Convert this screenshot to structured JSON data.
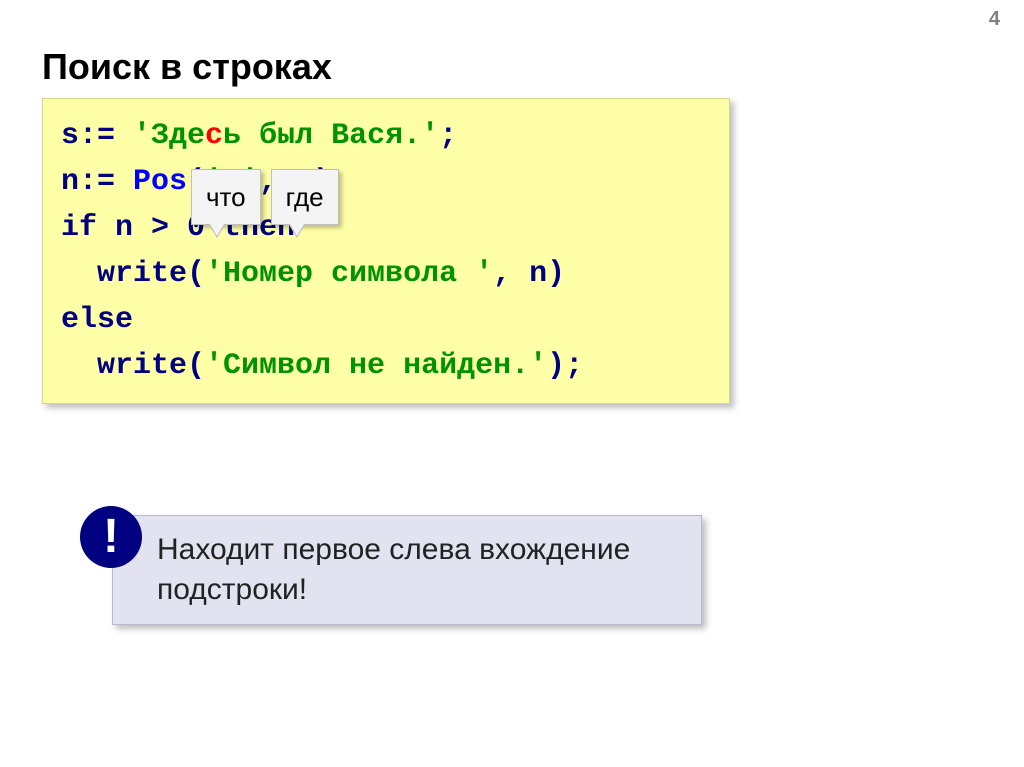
{
  "page_number": "4",
  "title": "Поиск в строках",
  "code": {
    "l1_a": "s:= ",
    "l1_b": "'Здe",
    "l1_c": "с",
    "l1_d": "ь был Вася.'",
    "l1_e": ";",
    "l2_blank": "",
    "l3_a": "n:= ",
    "l3_b": "Pos",
    "l3_c": "(",
    "l3_d": "'с'",
    "l3_e": ", s)",
    "l4": "if n > 0 then",
    "l5_a": "  write(",
    "l5_b": "'Номер символа '",
    "l5_c": ", n)",
    "l6": "else",
    "l7_a": "  write(",
    "l7_b": "'Символ не найден.'",
    "l7_c": ");"
  },
  "callouts": {
    "what": "что",
    "where": "где"
  },
  "note": {
    "line1": " Находит первое слева вхождение",
    "line2": "подстроки!",
    "excl": "!"
  }
}
